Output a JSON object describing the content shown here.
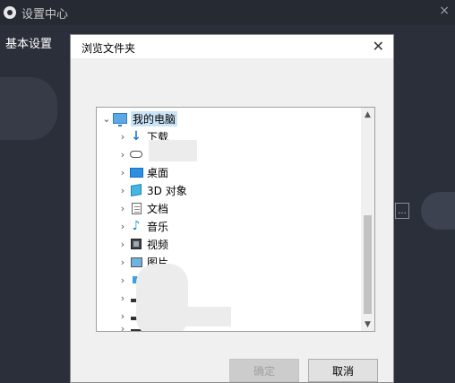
{
  "app": {
    "title": "设置中心",
    "close_glyph": "×"
  },
  "sidebar": {
    "items": [
      {
        "label": "基本设置"
      }
    ]
  },
  "browse_button_label": "...",
  "dialog": {
    "title": "浏览文件夹",
    "close_glyph": "✕",
    "tree": [
      {
        "label": "我的电脑",
        "icon": "computer-icon",
        "expanded": true,
        "selected": true
      },
      {
        "label": "下载",
        "icon": "download-icon"
      },
      {
        "label": "",
        "icon": "cloud-icon"
      },
      {
        "label": "桌面",
        "icon": "desktop-icon"
      },
      {
        "label": "3D 对象",
        "icon": "3d-objects-icon"
      },
      {
        "label": "文档",
        "icon": "document-icon"
      },
      {
        "label": "音乐",
        "icon": "music-icon"
      },
      {
        "label": "视频",
        "icon": "video-icon"
      },
      {
        "label": "图片",
        "icon": "picture-icon"
      },
      {
        "label": "",
        "icon": "network-icon"
      },
      {
        "label": "",
        "icon": "drive-icon"
      },
      {
        "label": "",
        "icon": "drive-icon"
      },
      {
        "label": "",
        "icon": "drive-icon"
      },
      {
        "label": "",
        "icon": "drive-icon"
      }
    ],
    "buttons": {
      "ok_label": "确定",
      "ok_enabled": false,
      "cancel_label": "取消"
    }
  },
  "colors": {
    "app_bg": "#2b2f3a",
    "titlebar_bg": "#262a33",
    "selected_bg": "#cce4f7"
  }
}
